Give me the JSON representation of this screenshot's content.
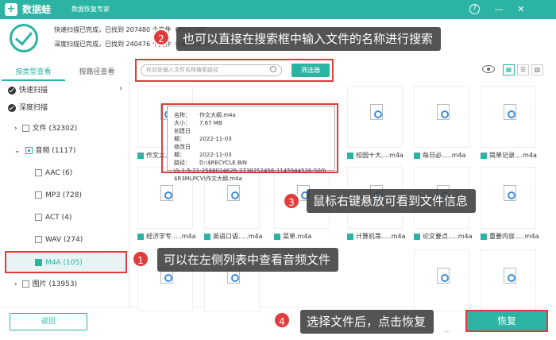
{
  "titlebar": {
    "app_name": "数据蛙",
    "app_sub": "数据恢复专家",
    "win_help": "?",
    "win_min": "—",
    "win_close": "✕"
  },
  "status": {
    "line1": "快速扫描已完成，已找到 207480 个文件（25.5 GB）",
    "line2": "深度扫描已完成，已找到 240476 个文件（26.12 GB）"
  },
  "tabs": [
    {
      "label": "按类型查看"
    },
    {
      "label": "按路径查看"
    }
  ],
  "sidebar": {
    "quick_scan": "快速扫描",
    "deep_scan": "深度扫描",
    "file": "文件 (32302)",
    "audio": "音频 (1117)",
    "aac": "AAC (6)",
    "mp3": "MP3 (728)",
    "act": "ACT (4)",
    "wav": "WAV (274)",
    "m4a": "M4A (105)",
    "image": "图片 (13953)"
  },
  "toolbar": {
    "search_placeholder": "在此处输入文件名称搜索路径",
    "filter_label": "筛选器",
    "view_grid": "▦",
    "view_list": "☰",
    "view_detail": "▥"
  },
  "grid": {
    "row1": [
      "作文大...",
      "",
      "",
      "",
      "校园十大....m4a",
      "每日必.....m4a",
      "简单记录....m4a"
    ],
    "row2": [
      "经济学专.....m4a",
      "英语口语.....m4a",
      "菜单.m4a",
      "计算机等.....m4a",
      "论文要点.....m4a",
      "重要内容.....m4a"
    ]
  },
  "tooltip": {
    "name_k": "名称：",
    "name_v": "作文大纲.m4a",
    "size_k": "大小：",
    "size_v": "7.67 MB",
    "created_k": "创建日期：",
    "created_v": "2022-11-03",
    "modified_k": "修改日期：",
    "modified_v": "2022-11-03",
    "path_k": "路径：",
    "path_v1": "D:\\$RECYCLE.BIN",
    "path_v2": "\\S-1-5-21-2588024626-3738252456-1145944526-500\\",
    "path_v3": "$R3MLPCV\\作文大纲.m4a"
  },
  "callouts": {
    "c1_num": "1",
    "c1": "可以在左侧列表中查看音频文件",
    "c2_num": "2",
    "c2": "也可以直接在搜索框中输入文件的名称进行搜索",
    "c3_num": "3",
    "c3": "鼠标右键悬放可看到文件信息",
    "c4_num": "4",
    "c4": "选择文件后，点击恢复"
  },
  "footer": {
    "back": "返回",
    "recover": "恢复",
    "watermark": "@稀土掘金技术社区"
  }
}
